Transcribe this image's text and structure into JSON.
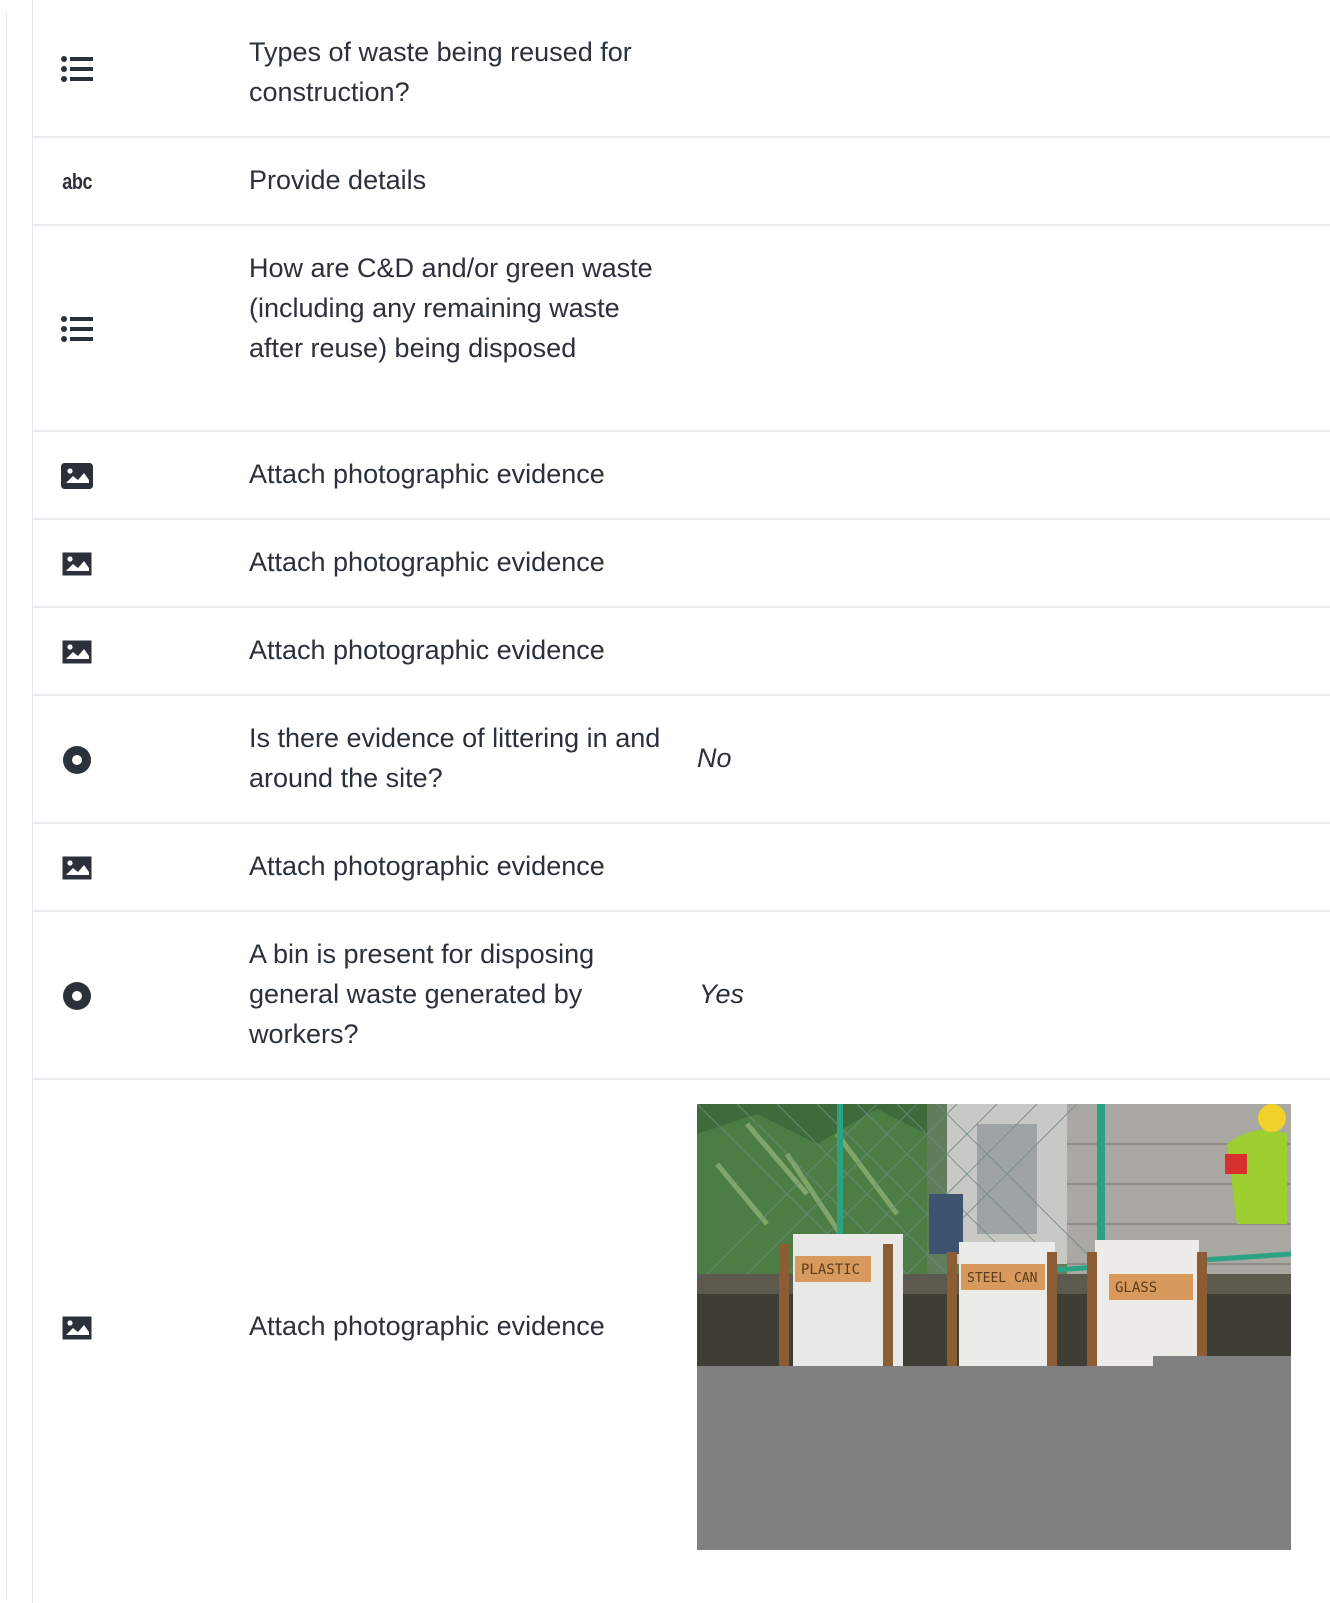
{
  "rows": [
    {
      "icon": "list-icon",
      "question": "Types of waste being reused for construction?",
      "answer": ""
    },
    {
      "icon": "text-icon",
      "icon_text": "abc",
      "question": "Provide details",
      "answer": ""
    },
    {
      "icon": "list-icon",
      "question": "How are C&D and/or green waste (including any remaining waste after reuse) being disposed",
      "answer": ""
    },
    {
      "icon": "image-icon",
      "question": "Attach photographic evidence",
      "answer": ""
    },
    {
      "icon": "image-icon",
      "question": "Attach photographic evidence",
      "answer": ""
    },
    {
      "icon": "image-icon",
      "question": "Attach photographic evidence",
      "answer": ""
    },
    {
      "icon": "radio-icon",
      "question": "Is there evidence of littering in and around the site?",
      "answer": "No"
    },
    {
      "icon": "image-icon",
      "question": "Attach photographic evidence",
      "answer": ""
    },
    {
      "icon": "radio-icon",
      "question": "A bin is present for disposing general waste generated by workers?",
      "answer": "Yes"
    },
    {
      "icon": "image-icon",
      "question": "Attach photographic evidence",
      "answer": "photo"
    }
  ],
  "photo": {
    "bin_labels": [
      "PLASTIC",
      "STEEL CAN",
      "GLASS"
    ]
  },
  "colors": {
    "text": "#2b313a",
    "divider": "#e8eaed",
    "photo_placeholder": "#808080"
  }
}
